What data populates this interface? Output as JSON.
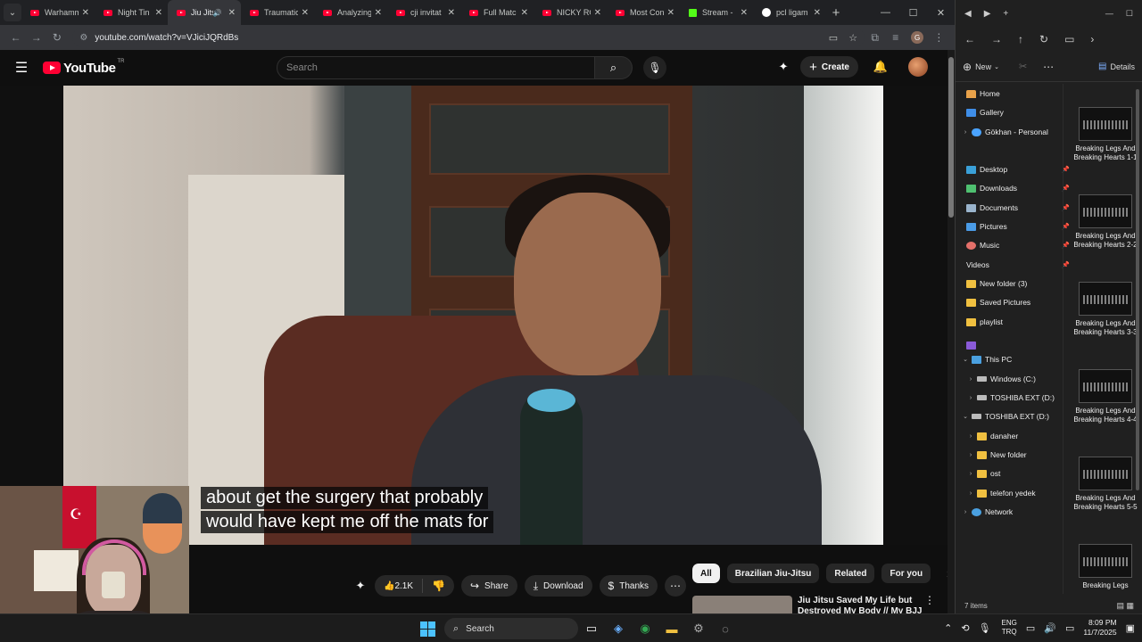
{
  "browser": {
    "tabs": [
      {
        "title": "Warhammer",
        "icon": "youtube-icon",
        "active": false
      },
      {
        "title": "Night Tin",
        "icon": "youtube-icon",
        "active": false
      },
      {
        "title": "Jiu Jitsu",
        "icon": "youtube-icon",
        "active": true,
        "audio": true
      },
      {
        "title": "Traumatic",
        "icon": "youtube-icon",
        "active": false
      },
      {
        "title": "Analyzing",
        "icon": "youtube-icon",
        "active": false
      },
      {
        "title": "cji invitat",
        "icon": "youtube-icon",
        "active": false
      },
      {
        "title": "Full Matc",
        "icon": "youtube-icon",
        "active": false
      },
      {
        "title": "NICKY RO",
        "icon": "youtube-icon",
        "active": false
      },
      {
        "title": "Most Con",
        "icon": "youtube-icon",
        "active": false
      },
      {
        "title": "Stream -",
        "icon": "kick-icon",
        "active": false
      },
      {
        "title": "pcl ligam",
        "icon": "google-icon",
        "active": false
      }
    ],
    "url": "youtube.com/watch?v=VJiciJQRdBs",
    "profile_initial": "G"
  },
  "youtube": {
    "logo_text": "YouTube",
    "country_code": "TR",
    "search_placeholder": "Search",
    "create_label": "Create",
    "subtitles": [
      "about get the surgery that probably",
      "would have kept me off the mats for"
    ],
    "like_count": "2.1K",
    "share_label": "Share",
    "download_label": "Download",
    "thanks_label": "Thanks",
    "chips": [
      "All",
      "Brazilian Jiu-Jitsu",
      "Related",
      "For you"
    ],
    "recommendation_title": "Jiu Jitsu Saved My Life but Destroyed My Body // My BJJ"
  },
  "explorer": {
    "new_label": "New",
    "details_label": "Details",
    "tree": [
      {
        "label": "Home",
        "icon": "home-icon"
      },
      {
        "label": "Gallery",
        "icon": "gallery-icon"
      },
      {
        "label": "Gökhan - Personal",
        "icon": "onedrive-icon"
      },
      {
        "label": "Desktop",
        "icon": "desktop-icon"
      },
      {
        "label": "Downloads",
        "icon": "downloads-icon"
      },
      {
        "label": "Documents",
        "icon": "documents-icon"
      },
      {
        "label": "Pictures",
        "icon": "pictures-icon"
      },
      {
        "label": "Music",
        "icon": "music-icon"
      },
      {
        "label": "Videos",
        "icon": "videos-icon"
      },
      {
        "label": "New folder (3)",
        "icon": "folder-icon"
      },
      {
        "label": "Saved Pictures",
        "icon": "folder-icon"
      },
      {
        "label": "playlist",
        "icon": "folder-icon"
      },
      {
        "label": "This PC",
        "icon": "pc-icon"
      },
      {
        "label": "Windows (C:)",
        "icon": "drive-icon"
      },
      {
        "label": "TOSHIBA EXT (D:)",
        "icon": "drive-icon"
      },
      {
        "label": "TOSHIBA EXT (D:)",
        "icon": "drive-icon"
      },
      {
        "label": "danaher",
        "icon": "folder-icon"
      },
      {
        "label": "New folder",
        "icon": "folder-icon"
      },
      {
        "label": "ost",
        "icon": "folder-icon"
      },
      {
        "label": "telefon yedek",
        "icon": "folder-icon"
      },
      {
        "label": "Network",
        "icon": "network-icon"
      }
    ],
    "files": [
      "Breaking Legs And Breaking Hearts 1-1",
      "Breaking Legs And Breaking Hearts 2-2",
      "Breaking Legs And Breaking Hearts 3-3",
      "Breaking Legs And Breaking Hearts 4-4",
      "Breaking Legs And Breaking Hearts 5-5",
      "Breaking Legs"
    ],
    "status": "7 items"
  },
  "taskbar": {
    "search_label": "Search",
    "lang_top": "ENG",
    "lang_bottom": "TRQ",
    "time": "8:09 PM",
    "date": "11/7/2025"
  }
}
